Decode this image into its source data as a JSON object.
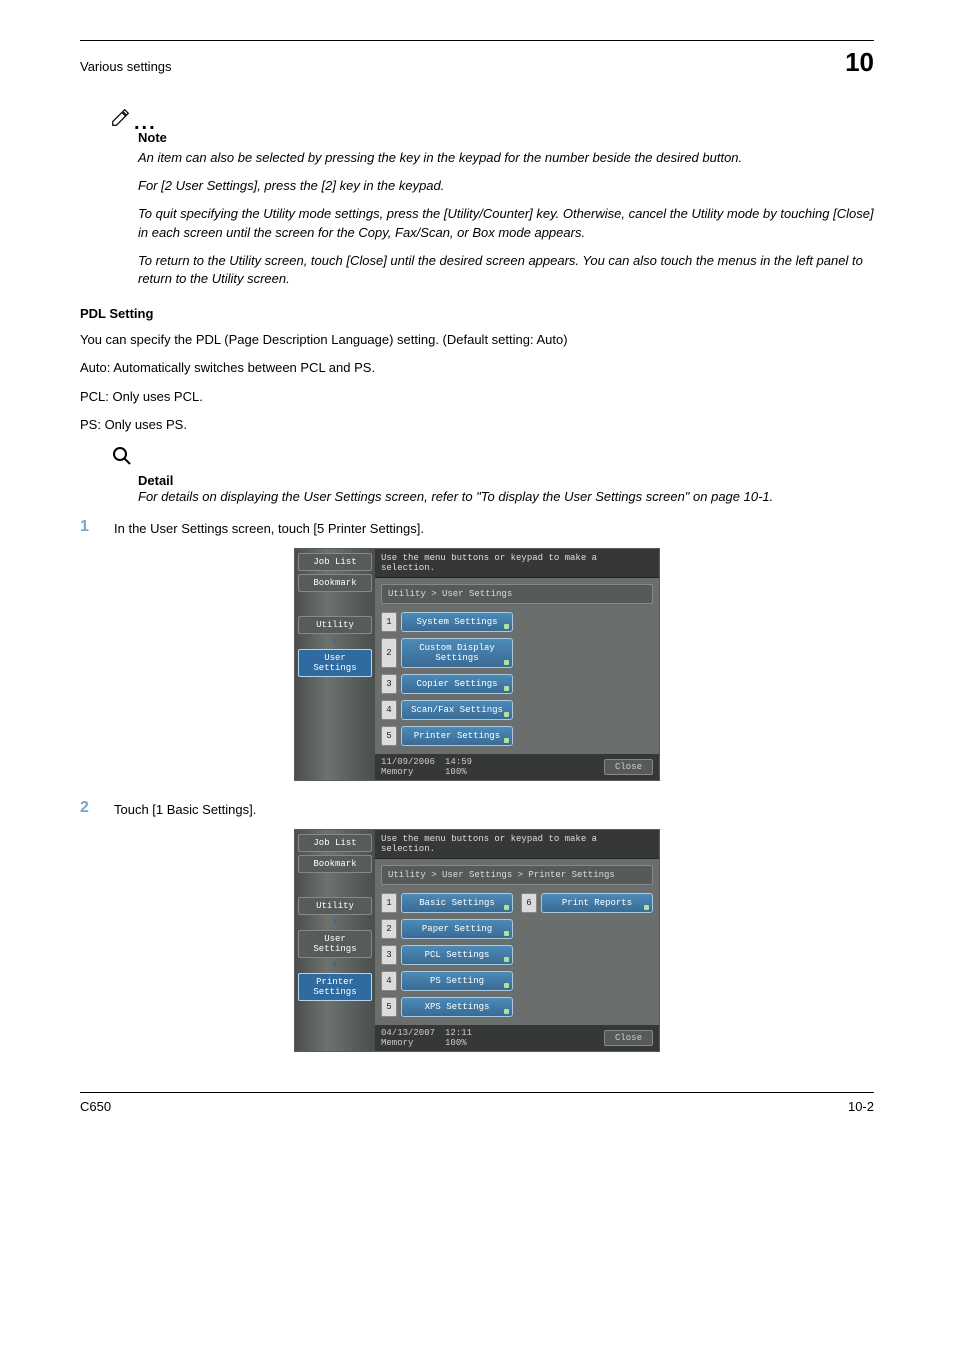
{
  "header": {
    "section_title": "Various settings",
    "chapter_number": "10"
  },
  "note_block": {
    "label": "Note",
    "p1": "An item can also be selected by pressing the key in the keypad for the number beside the desired button.",
    "p2": "For [2 User Settings], press the [2] key in the keypad.",
    "p3": "To quit specifying the Utility mode settings, press the [Utility/Counter] key. Otherwise, cancel the Utility mode by touching [Close] in each screen until the screen for the Copy, Fax/Scan, or Box mode appears.",
    "p4": "To return to the Utility screen, touch [Close] until the desired screen appears. You can also touch the menus in the left panel to return to the Utility screen."
  },
  "pdl": {
    "heading": "PDL Setting",
    "p1": "You can specify the PDL (Page Description Language) setting. (Default setting: Auto)",
    "p2": "Auto: Automatically switches between PCL and PS.",
    "p3": "PCL: Only uses PCL.",
    "p4": "PS: Only uses PS."
  },
  "detail": {
    "label": "Detail",
    "body": "For details on displaying the User Settings screen, refer to \"To display the User Settings screen\" on page 10-1."
  },
  "step1": {
    "num": "1",
    "text": "In the User Settings screen, touch [5 Printer Settings]."
  },
  "step2": {
    "num": "2",
    "text": "Touch [1 Basic Settings]."
  },
  "shot1": {
    "tabs": {
      "job_list": "Job List",
      "bookmark": "Bookmark",
      "utility": "Utility",
      "user_settings": "User Settings"
    },
    "instr": "Use the menu buttons or keypad to make a selection.",
    "crumb": "Utility > User Settings",
    "items": [
      {
        "n": "1",
        "label": "System Settings"
      },
      {
        "n": "2",
        "label": "Custom Display Settings"
      },
      {
        "n": "3",
        "label": "Copier Settings"
      },
      {
        "n": "4",
        "label": "Scan/Fax Settings"
      },
      {
        "n": "5",
        "label": "Printer Settings"
      }
    ],
    "foot": {
      "date": "11/09/2006",
      "time": "14:59",
      "mem_label": "Memory",
      "mem_val": "100%",
      "close": "Close"
    }
  },
  "shot2": {
    "tabs": {
      "job_list": "Job List",
      "bookmark": "Bookmark",
      "utility": "Utility",
      "user_settings": "User Settings",
      "printer_settings": "Printer Settings"
    },
    "instr": "Use the menu buttons or keypad to make a selection.",
    "crumb": "Utility > User Settings > Printer Settings",
    "items_col1": [
      {
        "n": "1",
        "label": "Basic Settings"
      },
      {
        "n": "2",
        "label": "Paper Setting"
      },
      {
        "n": "3",
        "label": "PCL Settings"
      },
      {
        "n": "4",
        "label": "PS Setting"
      },
      {
        "n": "5",
        "label": "XPS Settings"
      }
    ],
    "items_col2": [
      {
        "n": "6",
        "label": "Print Reports"
      }
    ],
    "foot": {
      "date": "04/13/2007",
      "time": "12:11",
      "mem_label": "Memory",
      "mem_val": "100%",
      "close": "Close"
    }
  },
  "footer": {
    "left": "C650",
    "right": "10-2"
  }
}
